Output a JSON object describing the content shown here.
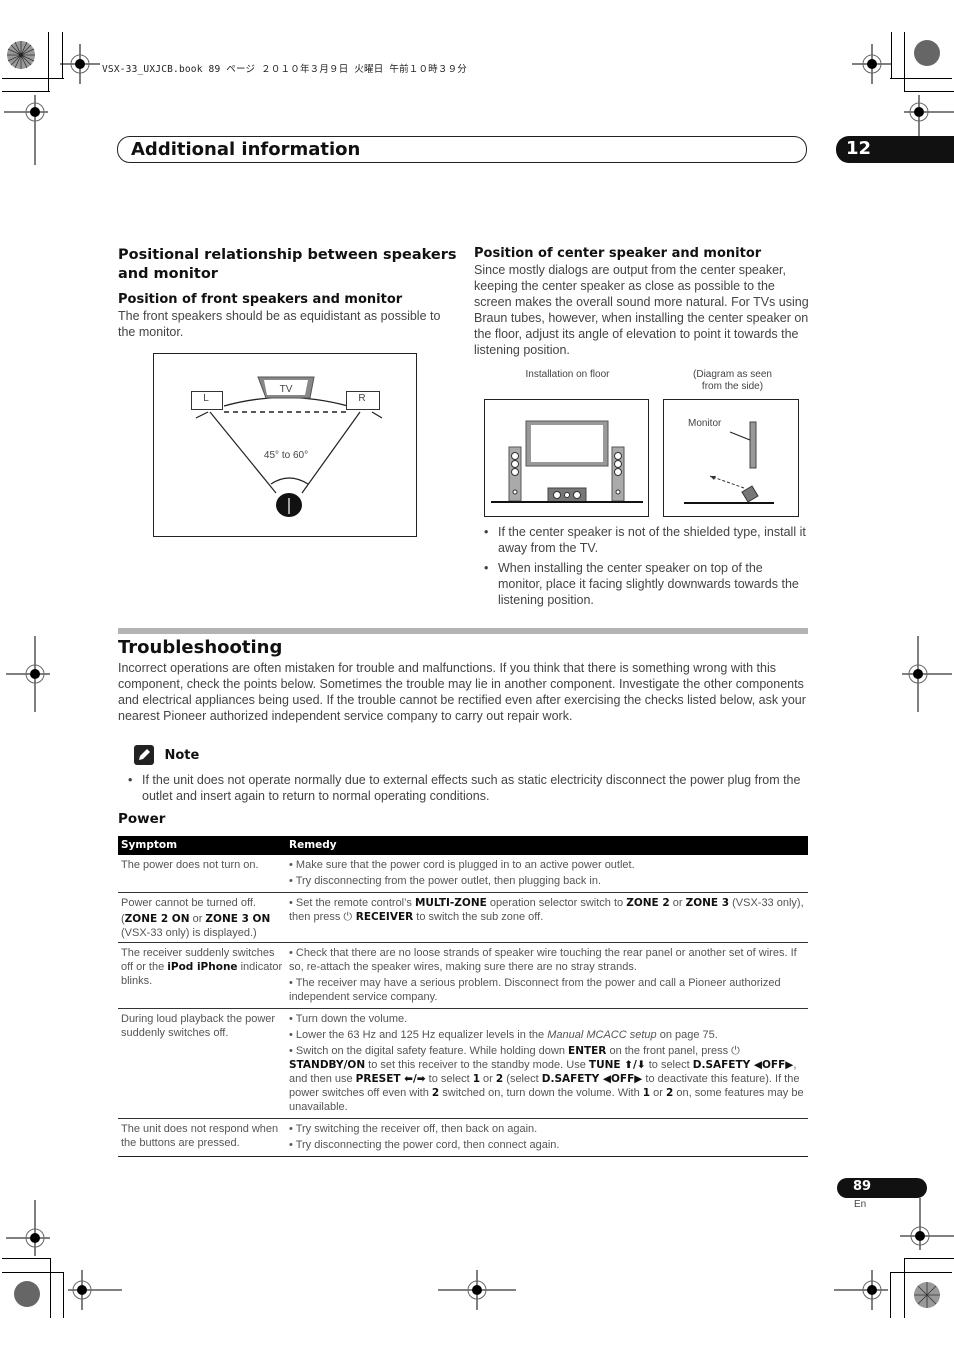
{
  "print_header": "VSX-33_UXJCB.book  89 ページ  ２０１０年３月９日  火曜日  午前１０時３９分",
  "chapter": {
    "title": "Additional information",
    "number": "12"
  },
  "positional": {
    "title": "Positional relationship between speakers and monitor",
    "front": {
      "heading": "Position of front speakers and monitor",
      "text": "The front speakers should be as equidistant as possible to the monitor.",
      "diagram": {
        "left_label": "L",
        "right_label": "R",
        "tv_label": "TV",
        "angle_label": "45° to 60°"
      }
    },
    "center": {
      "heading": "Position of center speaker and monitor",
      "text": "Since mostly dialogs are output from the center speaker, keeping the center speaker as close as possible to the screen makes the overall sound more natural. For TVs using Braun tubes, however, when installing the center speaker on the floor, adjust its angle of elevation to point it towards the listening position.",
      "diagram_floor_caption": "Installation on floor",
      "diagram_side_caption_1": "(Diagram as seen",
      "diagram_side_caption_2": "from the side)",
      "monitor_label": "Monitor",
      "bullets": [
        "If the center speaker is not of the shielded type, install it away from the TV.",
        "When installing the center speaker on top of the monitor, place it facing slightly downwards towards the listening position."
      ]
    }
  },
  "troubleshooting": {
    "title": "Troubleshooting",
    "intro": "Incorrect operations are often mistaken for trouble and malfunctions. If you think that there is something wrong with this component, check the points below. Sometimes the trouble may lie in another component. Investigate the other components and electrical appliances being used. If the trouble cannot be rectified even after exercising the checks listed below, ask your nearest Pioneer authorized independent service company to carry out repair work.",
    "note_label": "Note",
    "note_bullet": "If the unit does not operate normally due to external effects such as static electricity disconnect the power plug from the outlet and insert again to return to normal operating conditions.",
    "power": {
      "heading": "Power",
      "columns": [
        "Symptom",
        "Remedy"
      ],
      "rows": [
        {
          "symptom": "The power does not turn on.",
          "remedies": [
            "• Make sure that the power cord is plugged in to an active power outlet.",
            "• Try disconnecting from the power outlet, then plugging back in."
          ]
        },
        {
          "symptom_a": "Power cannot be turned off.",
          "symptom_b1": "(",
          "symptom_b_bold1": "ZONE 2 ON",
          "symptom_b2": " or ",
          "symptom_b_bold2": "ZONE 3 ON",
          "symptom_c": "(VSX-33 only) is displayed.)",
          "r1": "• Set the remote control’s ",
          "r1_b1": "MULTI-ZONE",
          "r1_2": " operation selector switch to ",
          "r1_b2": "ZONE 2",
          "r1_3": " or ",
          "r1_b3": "ZONE 3",
          "r1_4": " (VSX-33 only), then press ",
          "r1_icon": "⏻",
          "r1_b4": " RECEIVER",
          "r1_5": " to switch the sub zone off."
        },
        {
          "symptom_a": "The receiver suddenly switches off or the ",
          "symptom_bold": "iPod iPhone",
          "symptom_c": " indicator blinks.",
          "remedies": [
            "• Check that there are no loose strands of speaker wire touching the rear panel or another set of wires. If so, re-attach the speaker wires, making sure there are no stray strands.",
            "• The receiver may have a serious problem. Disconnect from the power and call a Pioneer authorized independent service company."
          ]
        },
        {
          "symptom": "During loud playback the power suddenly switches off.",
          "r1": "• Turn down the volume.",
          "r2a": "• Lower the 63 Hz and 125 Hz equalizer levels in the ",
          "r2_italic": "Manual MCACC setup",
          "r2b": " on page 75.",
          "r3": {
            "t1": "• Switch on the digital safety feature. While holding down ",
            "b1": "ENTER",
            "t2": " on the front panel, press ",
            "icon": "⏻",
            "b2": " STANDBY/ON",
            "t3": " to set this receiver to the standby mode. Use ",
            "b3": "TUNE ⬆/⬇",
            "t4": " to select ",
            "b4": "D.SAFETY ◀OFF▶",
            "t5": ", and then use ",
            "b5": "PRESET ⬅/➡",
            "t6": " to select ",
            "b6": "1",
            "t7": " or ",
            "b7": "2",
            "t8": " (select ",
            "b8": "D.SAFETY ◀OFF▶",
            "t9": " to deactivate this feature). If the power switches off even with ",
            "b9": "2",
            "t10": " switched on, turn down the volume. With ",
            "b10": "1",
            "t11": " or ",
            "b11": "2",
            "t12": " on, some features may be unavailable."
          }
        },
        {
          "symptom": "The unit does not respond when the buttons are pressed.",
          "remedies": [
            "• Try switching the receiver off, then back on again.",
            "• Try disconnecting the power cord, then connect again."
          ]
        }
      ]
    }
  },
  "footer": {
    "page_number": "89",
    "language": "En"
  }
}
